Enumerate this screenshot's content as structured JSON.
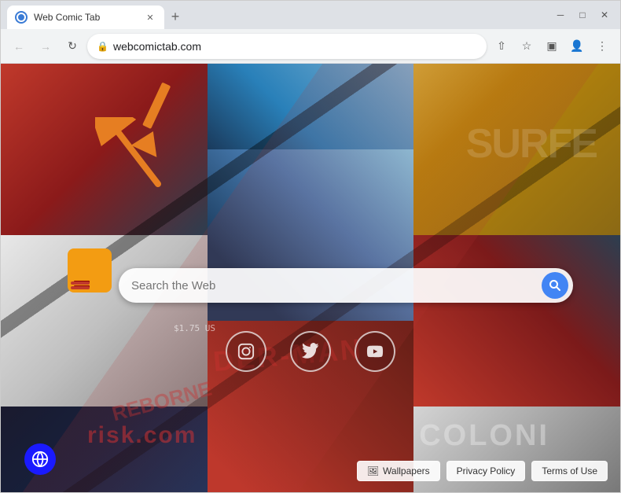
{
  "browser": {
    "tab_title": "Web Comic Tab",
    "url": "webcomictab.com",
    "new_tab_label": "+",
    "window_minimize": "─",
    "window_restore": "□",
    "window_close": "✕"
  },
  "nav": {
    "back_tooltip": "Back",
    "forward_tooltip": "Forward",
    "refresh_tooltip": "Refresh",
    "share_tooltip": "Share",
    "bookmark_tooltip": "Bookmark",
    "profile_tooltip": "Profile",
    "menu_tooltip": "Menu",
    "address": "webcomictab.com",
    "lock_symbol": "🔒"
  },
  "search": {
    "placeholder": "Search the Web",
    "button_label": "🔍"
  },
  "social": {
    "instagram_label": "📷",
    "twitter_label": "🐦",
    "youtube_label": "▶"
  },
  "bottom_bar": {
    "wallpapers_icon": "🖼",
    "wallpapers_label": "Wallpapers",
    "privacy_label": "Privacy Policy",
    "terms_label": "Terms of Use"
  },
  "comics": {
    "surfer_text": "SURFE",
    "spiderman_text": "DER-MAN",
    "reborn_text": "REBORNE",
    "risk_text": "risk.com",
    "colon_text": "COLONI",
    "price_text": "$1.75 US"
  }
}
